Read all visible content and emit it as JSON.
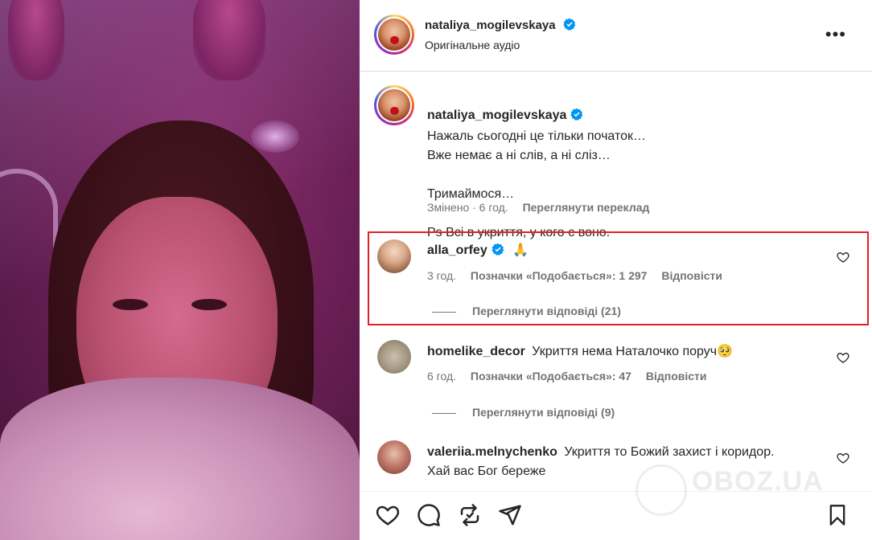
{
  "post": {
    "author": "nataliya_mogilevskaya",
    "audio": "Оригінальне аудіо",
    "more_icon": "more-horizontal-icon",
    "caption_lines": "Нажаль сьогодні це тільки початок…\nВже немає а ні слів, а ні сліз…\n\nТримаймося…\n\nPs Всі в укриття, у кого є воно.",
    "caption_meta": {
      "edited": "Змінено · 6 год.",
      "translate": "Переглянути переклад"
    }
  },
  "comments": [
    {
      "username": "alla_orfey",
      "verified": true,
      "text": "🙏",
      "time": "3 год.",
      "likes": "Позначки «Подобається»: 1 297",
      "reply": "Відповісти",
      "view_replies": "Переглянути відповіді (21)"
    },
    {
      "username": "homelike_decor",
      "verified": false,
      "text": "Укриття нема Наталочко поруч🥺",
      "time": "6 год.",
      "likes": "Позначки «Подобається»: 47",
      "reply": "Відповісти",
      "view_replies": "Переглянути відповіді (9)"
    },
    {
      "username": "valeriia.melnychenko",
      "verified": false,
      "text": "Укриття то Божий захист і коридор.",
      "text2": "Хай вас Бог береже"
    }
  ],
  "actions": {
    "icons": [
      "heart-icon",
      "comment-icon",
      "repost-icon",
      "share-icon",
      "bookmark-icon"
    ]
  },
  "watermark": "OBOZ.UA",
  "colors": {
    "verified": "#0095f6",
    "highlight": "#e0202a",
    "muted": "#737373"
  }
}
